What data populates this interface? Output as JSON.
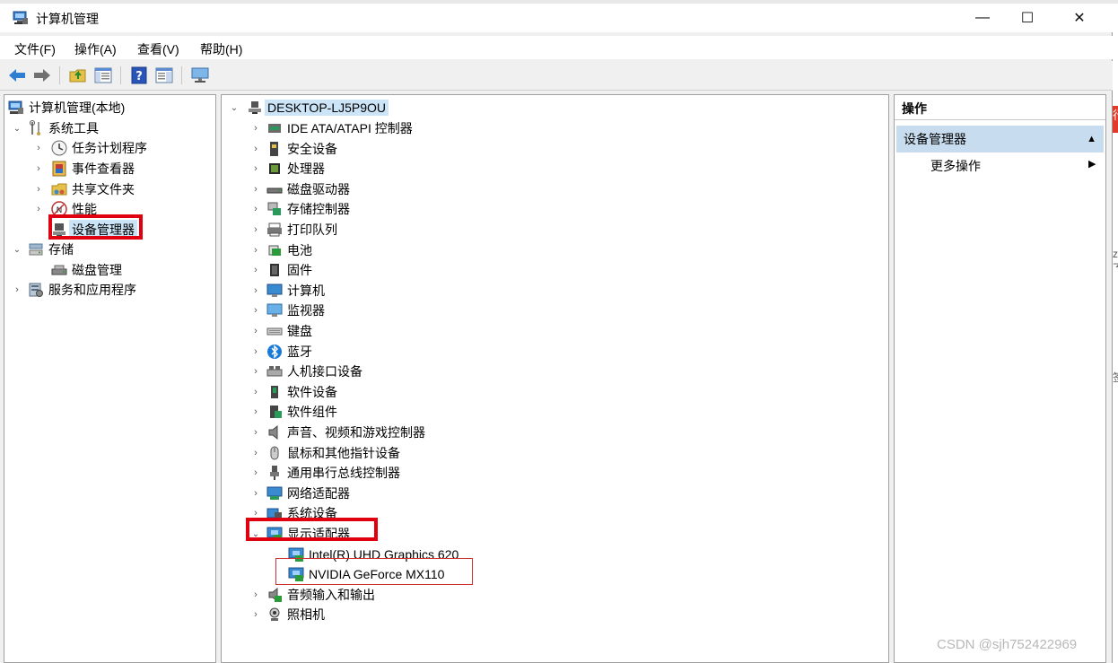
{
  "window": {
    "title": "计算机管理",
    "controls": {
      "minimize": "—",
      "maximize": "☐",
      "close": "✕"
    }
  },
  "menu": {
    "file": "文件(F)",
    "action": "操作(A)",
    "view": "查看(V)",
    "help": "帮助(H)"
  },
  "toolbar": {
    "buttons": [
      "back-icon",
      "forward-icon",
      "up-folder-icon",
      "show-hide-tree-icon",
      "help-icon",
      "properties-icon",
      "monitor-icon"
    ]
  },
  "left_tree": {
    "root": "计算机管理(本地)",
    "system_tools": "系统工具",
    "task_scheduler": "任务计划程序",
    "event_viewer": "事件查看器",
    "shared_folders": "共享文件夹",
    "performance": "性能",
    "device_manager": "设备管理器",
    "storage": "存储",
    "disk_management": "磁盘管理",
    "services_apps": "服务和应用程序"
  },
  "device_tree": {
    "computer": "DESKTOP-LJ5P9OU",
    "categories": [
      "IDE ATA/ATAPI 控制器",
      "安全设备",
      "处理器",
      "磁盘驱动器",
      "存储控制器",
      "打印队列",
      "电池",
      "固件",
      "计算机",
      "监视器",
      "键盘",
      "蓝牙",
      "人机接口设备",
      "软件设备",
      "软件组件",
      "声音、视频和游戏控制器",
      "鼠标和其他指针设备",
      "通用串行总线控制器",
      "网络适配器",
      "系统设备"
    ],
    "display_adapters": "显示适配器",
    "adapters": [
      "Intel(R) UHD Graphics 620",
      "NVIDIA GeForce MX110"
    ],
    "after": [
      "音频输入和输出",
      "照相机"
    ]
  },
  "actions": {
    "title": "操作",
    "group": "设备管理器",
    "more": "更多操作"
  },
  "background": {
    "edge_text_1": "行",
    "edge_text_2": "z不",
    "edge_text_3": "签"
  },
  "watermark": "CSDN @sjh752422969",
  "colors": {
    "highlight_red": "#e00010",
    "selection_blue": "#cce4f7",
    "actions_header": "#c7dcee"
  }
}
